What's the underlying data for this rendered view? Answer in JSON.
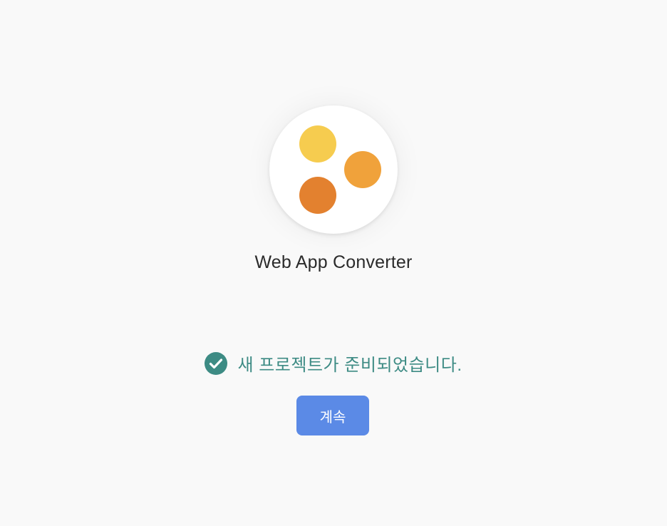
{
  "app": {
    "title": "Web App Converter",
    "logo": {
      "icon": "three-dots-logo-icon",
      "colors": [
        "#f6cc4f",
        "#f0a23b",
        "#e3812f"
      ]
    }
  },
  "status": {
    "icon": "check-circle-icon",
    "message": "새 프로젝트가 준비되었습니다.",
    "color": "#3d8b84"
  },
  "actions": {
    "continue_label": "계속",
    "continue_color": "#5b8ae6"
  }
}
